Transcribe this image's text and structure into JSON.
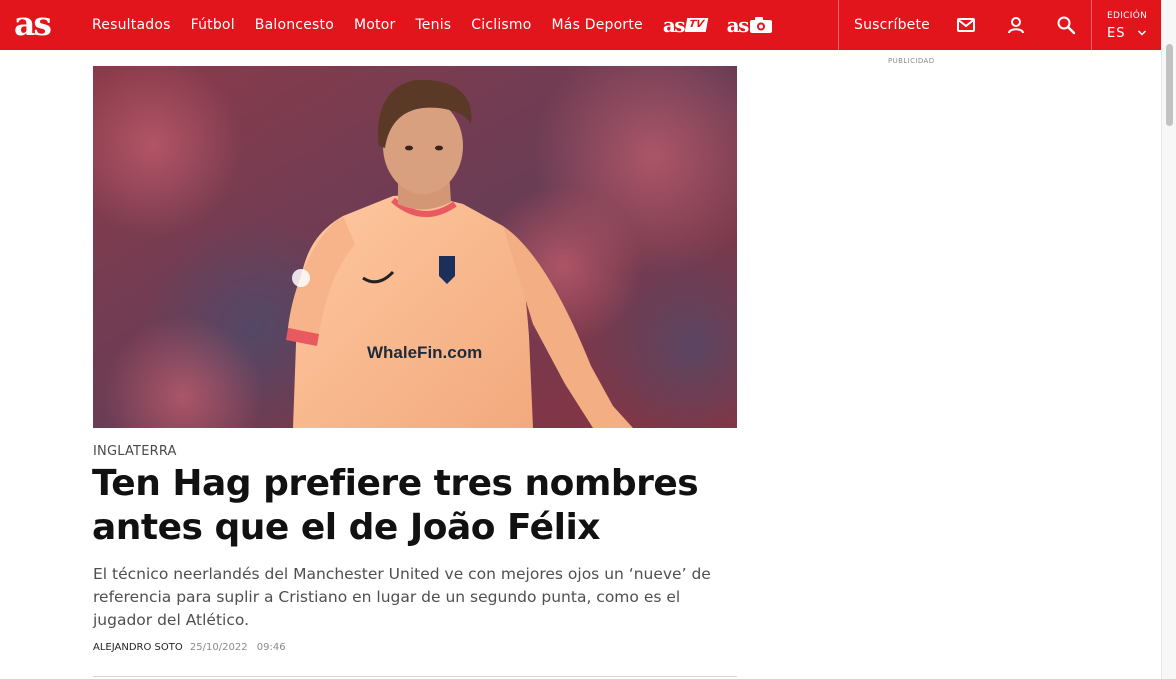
{
  "header": {
    "logo_text": "as",
    "nav": [
      {
        "label": "Resultados"
      },
      {
        "label": "Fútbol"
      },
      {
        "label": "Baloncesto"
      },
      {
        "label": "Motor"
      },
      {
        "label": "Tenis"
      },
      {
        "label": "Ciclismo"
      },
      {
        "label": "Más Deporte"
      }
    ],
    "astv": {
      "brand": "as",
      "badge": "TV"
    },
    "asphoto": {
      "brand": "as"
    },
    "subscribe_label": "Suscríbete",
    "edition_label": "EDICIÓN",
    "edition_value": "ES",
    "icons": {
      "newsletter": "mail-icon",
      "account": "user-icon",
      "search": "search-icon",
      "edition": "chevron-down-icon"
    }
  },
  "ad": {
    "label": "PUBLICIDAD"
  },
  "article": {
    "image_alt": "João Félix con la camiseta naranja del Atlético",
    "shirt_text": "WhaleFin.com",
    "kicker": "INGLATERRA",
    "headline": "Ten Hag prefiere tres nombres antes que el de João Félix",
    "standfirst": "El técnico neerlandés del Manchester United ve con mejores ojos un ‘nueve’ de referencia para suplir a Cristiano en lugar de un segundo punta, como es el jugador del Atlético.",
    "author": "ALEJANDRO SOTO",
    "date": "25/10/2022",
    "time": "09:46"
  },
  "colors": {
    "brand_red": "#e2141c",
    "headline": "#111111",
    "standfirst": "#4f4f4f",
    "meta": "#8a8a8a"
  }
}
